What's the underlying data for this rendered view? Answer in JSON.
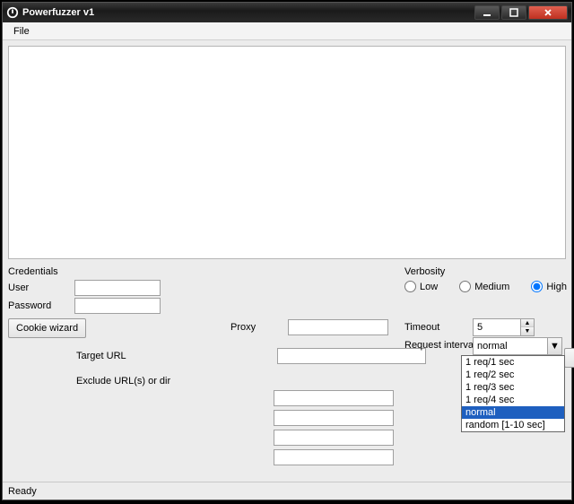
{
  "window": {
    "title": "Powerfuzzer v1"
  },
  "menu": {
    "file": "File"
  },
  "credentials": {
    "section": "Credentials",
    "user_label": "User",
    "password_label": "Password",
    "user_value": "",
    "password_value": "",
    "cookie_wizard": "Cookie wizard"
  },
  "proxy": {
    "label": "Proxy",
    "value": ""
  },
  "target": {
    "label": "Target URL",
    "value": ""
  },
  "exclude": {
    "label": "Exclude URL(s) or dir",
    "v1": "",
    "v2": "",
    "v3": "",
    "v4": ""
  },
  "verbosity": {
    "section": "Verbosity",
    "low": "Low",
    "medium": "Medium",
    "high": "High",
    "selected": "high"
  },
  "timeout": {
    "label": "Timeout",
    "value": "5"
  },
  "request_interval": {
    "label": "Request interval",
    "value": "normal",
    "options": [
      "1 req/1 sec",
      "1 req/2 sec",
      "1 req/3 sec",
      "1 req/4 sec",
      "normal",
      "random [1-10 sec]"
    ]
  },
  "status": {
    "text": "Ready"
  }
}
